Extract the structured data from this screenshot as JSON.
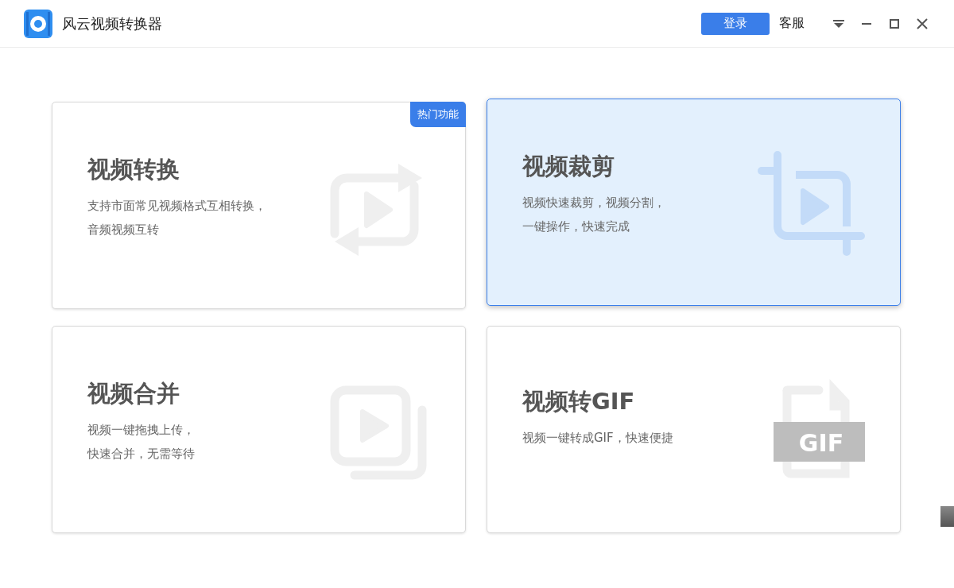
{
  "window": {
    "title": "风云视频转换器"
  },
  "header": {
    "login_button": "登录",
    "service_link": "客服"
  },
  "cards": [
    {
      "kind": "convert",
      "title": "视频转换",
      "description": [
        "支持市面常见视频格式互相转换，",
        "音频视频互转"
      ],
      "badge": "热门功能",
      "selected": false
    },
    {
      "kind": "crop",
      "title": "视频裁剪",
      "description": [
        "视频快速裁剪，视频分割，",
        "一键操作，快速完成"
      ],
      "selected": true
    },
    {
      "kind": "merge",
      "title": "视频合并",
      "description": [
        "视频一键拖拽上传，",
        "快速合并，无需等待"
      ],
      "selected": false
    },
    {
      "kind": "gif",
      "title": "视频转GIF",
      "description": [
        "视频一键转成GIF，快速便捷"
      ],
      "icon_text": "GIF",
      "selected": false
    }
  ]
}
